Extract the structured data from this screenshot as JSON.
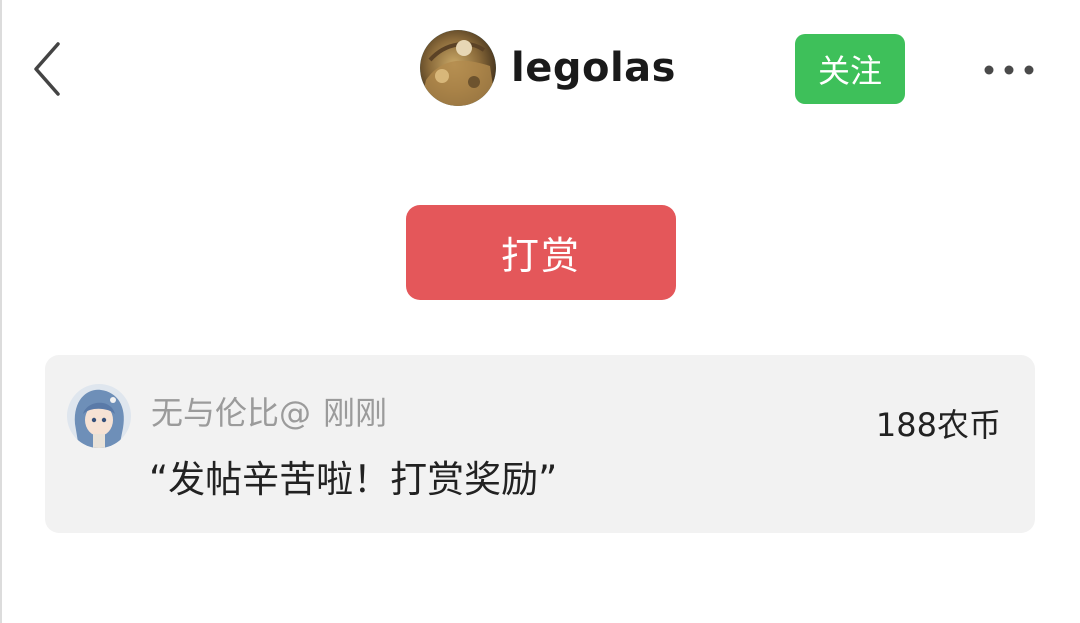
{
  "header": {
    "username": "legolas",
    "follow_label": "关注"
  },
  "actions": {
    "reward_label": "打赏"
  },
  "reward_record": {
    "sender_name": "无与伦比@",
    "time": "刚刚",
    "amount": "188农币",
    "message": "“发帖辛苦啦！打赏奖励”"
  },
  "colors": {
    "follow_green": "#3ec05a",
    "reward_red": "#e4575a",
    "card_bg": "#f2f2f2",
    "muted_text": "#9b9b9b"
  },
  "icons": {
    "back": "chevron-left-icon",
    "more": "more-dots-icon"
  }
}
